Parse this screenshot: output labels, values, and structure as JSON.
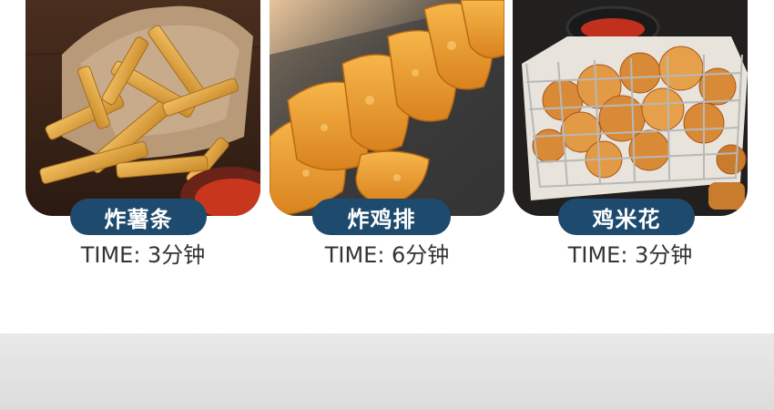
{
  "items": [
    {
      "name": "炸薯条",
      "time": "TIME: 3分钟",
      "image": "fries-photo"
    },
    {
      "name": "炸鸡排",
      "time": "TIME: 6分钟",
      "image": "chicken-cutlet-photo"
    },
    {
      "name": "鸡米花",
      "time": "TIME: 3分钟",
      "image": "popcorn-chicken-photo"
    }
  ],
  "colors": {
    "pill": "#1e4a6e",
    "pill_text": "#ffffff",
    "time_text": "#333333",
    "bottom_band": "#e2e2e2"
  }
}
